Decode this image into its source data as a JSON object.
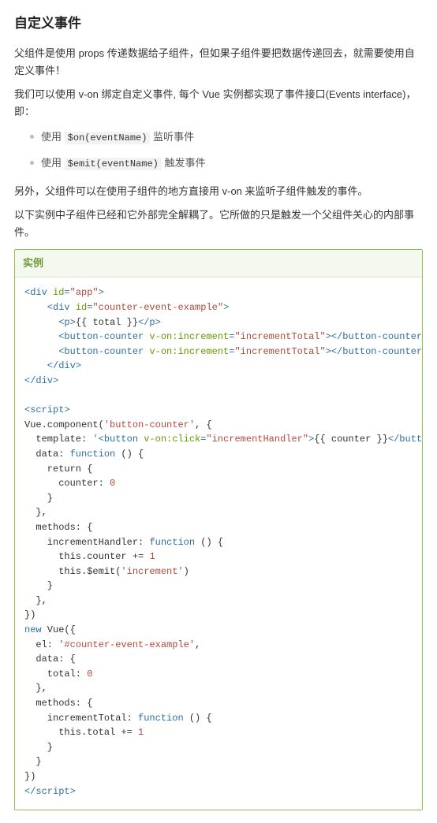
{
  "heading": "自定义事件",
  "paragraphs": {
    "p1": "父组件是使用 props 传递数据给子组件，但如果子组件要把数据传递回去，就需要使用自定义事件！",
    "p2_a": "我们可以使用 v-on 绑定自定义事件, 每个 Vue 实例都实现了事件接口(Events interface)，即：",
    "p3": "另外，父组件可以在使用子组件的地方直接用 v-on 来监听子组件触发的事件。",
    "p4": "以下实例中子组件已经和它外部完全解耦了。它所做的只是触发一个父组件关心的内部事件。"
  },
  "bullets": {
    "b1_pre": "使用 ",
    "b1_code": "$on(eventName)",
    "b1_post": " 监听事件",
    "b2_pre": "使用 ",
    "b2_code": "$emit(eventName)",
    "b2_post": " 触发事件"
  },
  "example_label": "实例",
  "code": {
    "line1_a": "<div ",
    "line1_b": "id",
    "line1_c": "=",
    "line1_d": "\"app\"",
    "line1_e": ">",
    "line2_a": "    <div ",
    "line2_b": "id",
    "line2_c": "=",
    "line2_d": "\"counter-event-example\"",
    "line2_e": ">",
    "line3_a": "      <p>",
    "line3_b": "{{ total }}",
    "line3_c": "</p>",
    "line4_a": "      <button-counter ",
    "line4_b": "v-on:increment",
    "line4_c": "=",
    "line4_d": "\"incrementTotal\"",
    "line4_e": "></button-counter>",
    "line5_a": "      <button-counter ",
    "line5_b": "v-on:increment",
    "line5_c": "=",
    "line5_d": "\"incrementTotal\"",
    "line5_e": "></button-counter>",
    "line6": "    </div>",
    "line7": "</div>",
    "blank1": " ",
    "line8": "<script>",
    "line9_a": "Vue.component(",
    "line9_b": "'button-counter'",
    "line9_c": ", {",
    "line10_a": "  template: ",
    "line10_b": "'",
    "line10_c": "<button ",
    "line10_d": "v-on:click",
    "line10_e": "=",
    "line10_f": "\"incrementHandler\"",
    "line10_g": ">",
    "line10_h": "{{ counter }}",
    "line10_i": "</button>",
    "line10_j": "'",
    "line10_k": ",",
    "line11_a": "  data: ",
    "line11_b": "function",
    "line11_c": " () {",
    "line12": "    return {",
    "line13_a": "      counter: ",
    "line13_b": "0",
    "line14": "    }",
    "line15": "  },",
    "line16": "  methods: {",
    "line17_a": "    incrementHandler: ",
    "line17_b": "function",
    "line17_c": " () {",
    "line18_a": "      this.counter += ",
    "line18_b": "1",
    "line19_a": "      this.$emit(",
    "line19_b": "'increment'",
    "line19_c": ")",
    "line20": "    }",
    "line21": "  },",
    "line22": "})",
    "line23_a": "new",
    "line23_b": " Vue({",
    "line24_a": "  el: ",
    "line24_b": "'#counter-event-example'",
    "line24_c": ",",
    "line25": "  data: {",
    "line26_a": "    total: ",
    "line26_b": "0",
    "line27": "  },",
    "line28": "  methods: {",
    "line29_a": "    incrementTotal: ",
    "line29_b": "function",
    "line29_c": " () {",
    "line30_a": "      this.total += ",
    "line30_b": "1",
    "line31": "    }",
    "line32": "  }",
    "line33": "})",
    "line34": "</script>"
  }
}
